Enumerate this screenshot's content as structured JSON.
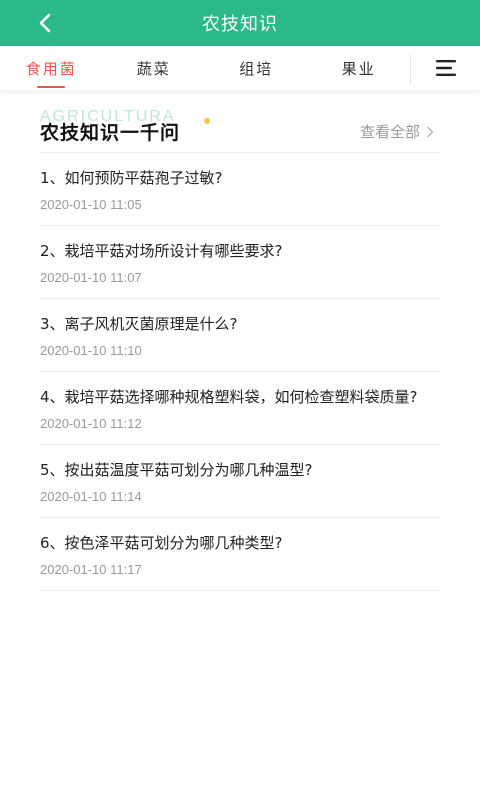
{
  "header": {
    "title": "农技知识",
    "back_icon": "chevron-left-icon",
    "bg_color": "#2bb98a"
  },
  "tabs": [
    {
      "label": "食用菌",
      "active": true
    },
    {
      "label": "蔬菜",
      "active": false
    },
    {
      "label": "组培",
      "active": false
    },
    {
      "label": "果业",
      "active": false
    }
  ],
  "menu_icon": "menu-icon",
  "accent_color": "#f0564a",
  "section": {
    "watermark": "AGRICULTURA",
    "title": "农技知识一千问",
    "view_all": "查看全部"
  },
  "items": [
    {
      "title": "1、如何预防平菇孢子过敏?",
      "time": "2020-01-10 11:05"
    },
    {
      "title": "2、栽培平菇对场所设计有哪些要求?",
      "time": "2020-01-10 11:07"
    },
    {
      "title": "3、离子风机灭菌原理是什么?",
      "time": "2020-01-10 11:10"
    },
    {
      "title": "4、栽培平菇选择哪种规格塑料袋，如何检查塑料袋质量?",
      "time": "2020-01-10 11:12"
    },
    {
      "title": "5、按出菇温度平菇可划分为哪几种温型?",
      "time": "2020-01-10 11:14"
    },
    {
      "title": "6、按色泽平菇可划分为哪几种类型?",
      "time": "2020-01-10 11:17"
    }
  ]
}
